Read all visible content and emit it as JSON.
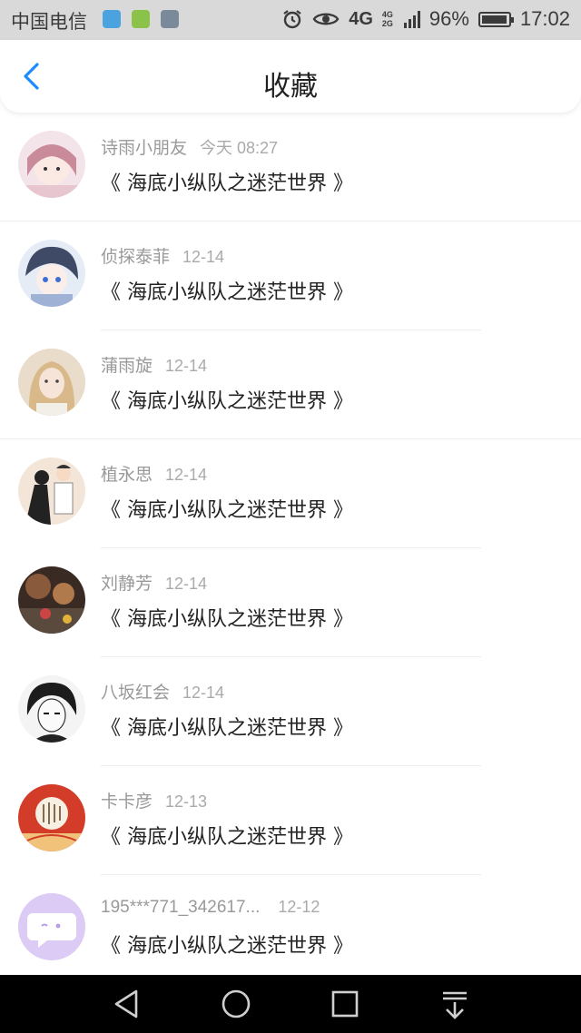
{
  "status_bar": {
    "carrier": "中国电信",
    "network": "4G",
    "network_sub": "4G 2G",
    "battery": "96%",
    "battery_level": 0.96,
    "time": "17:02"
  },
  "header": {
    "title": "收藏",
    "back_icon": "chevron-left-icon",
    "accent": "#1a8cff"
  },
  "items": [
    {
      "name": "诗雨小朋友",
      "date": "今天 08:27",
      "subject": "《 海底小纵队之迷茫世界 》",
      "avatar": "anime-girl-pink"
    },
    {
      "name": "侦探泰菲",
      "date": "12-14",
      "subject": "《 海底小纵队之迷茫世界 》",
      "avatar": "anime-boy-blue"
    },
    {
      "name": "蒲雨旋",
      "date": "12-14",
      "subject": "《 海底小纵队之迷茫世界 》",
      "avatar": "girl-photo"
    },
    {
      "name": "植永思",
      "date": "12-14",
      "subject": "《 海底小纵队之迷茫世界 》",
      "avatar": "illustration-couple"
    },
    {
      "name": "刘静芳",
      "date": "12-14",
      "subject": "《 海底小纵队之迷茫世界 》",
      "avatar": "street-photo"
    },
    {
      "name": "八坂红会",
      "date": "12-14",
      "subject": "《 海底小纵队之迷茫世界 》",
      "avatar": "manga-sketch"
    },
    {
      "name": "卡卡彦",
      "date": "12-13",
      "subject": "《 海底小纵队之迷茫世界 》",
      "avatar": "red-card"
    },
    {
      "name": "195***771_342617...",
      "date": "12-12",
      "subject": "《 海底小纵队之迷茫世界 》",
      "avatar": "default-chat-bubble"
    }
  ],
  "nav": {
    "back": "back-triangle-icon",
    "home": "home-circle-icon",
    "recents": "recents-square-icon",
    "notification": "pull-down-icon"
  }
}
